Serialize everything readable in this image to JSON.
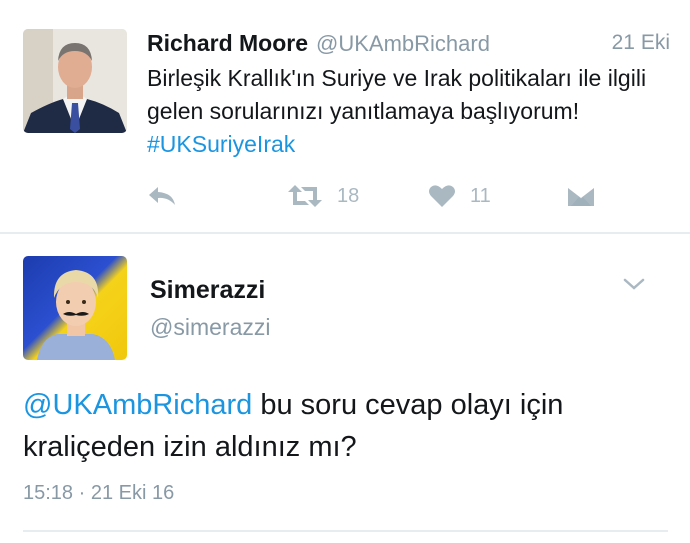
{
  "tweet1": {
    "name": "Richard Moore",
    "handle": "@UKAmbRichard",
    "date": "21 Eki",
    "text_before": "Birleşik Krallık'ın Suriye ve Irak politikaları ile ilgili gelen sorularınızı yanıtlamaya başlıyorum! ",
    "hashtag": "#UKSuriyeIrak",
    "actions": {
      "reply_icon": "reply-icon",
      "retweet_icon": "retweet-icon",
      "retweet_count": "18",
      "like_icon": "heart-icon",
      "like_count": "11",
      "dm_icon": "envelope-icon"
    }
  },
  "tweet2": {
    "name": "Simerazzi",
    "handle": "@simerazzi",
    "mention": "@UKAmbRichard",
    "text_after": " bu soru cevap olayı için kraliçeden izin aldınız mı?",
    "timestamp": "15:18 · 21 Eki 16",
    "menu_icon": "chevron-down-icon"
  },
  "colors": {
    "link": "#1b95e0",
    "secondary_text": "#8899a6",
    "action_icon": "#aab8c2",
    "divider": "#e6ecf0"
  }
}
